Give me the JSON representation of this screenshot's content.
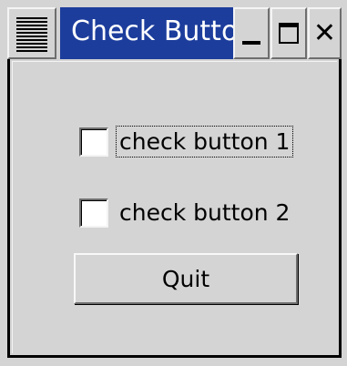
{
  "window": {
    "title": "Check Button",
    "menu_icon": "window-menu-icon",
    "minimize_icon": "minimize-icon",
    "maximize_icon": "maximize-icon",
    "close_icon": "close-icon",
    "close_glyph": "✕"
  },
  "checks": [
    {
      "label": "check button 1",
      "checked": false,
      "focused": true
    },
    {
      "label": "check button 2",
      "checked": false,
      "focused": false
    }
  ],
  "quit_label": "Quit",
  "colors": {
    "title_bar": "#1c3d9c",
    "background": "#d4d4d4"
  }
}
